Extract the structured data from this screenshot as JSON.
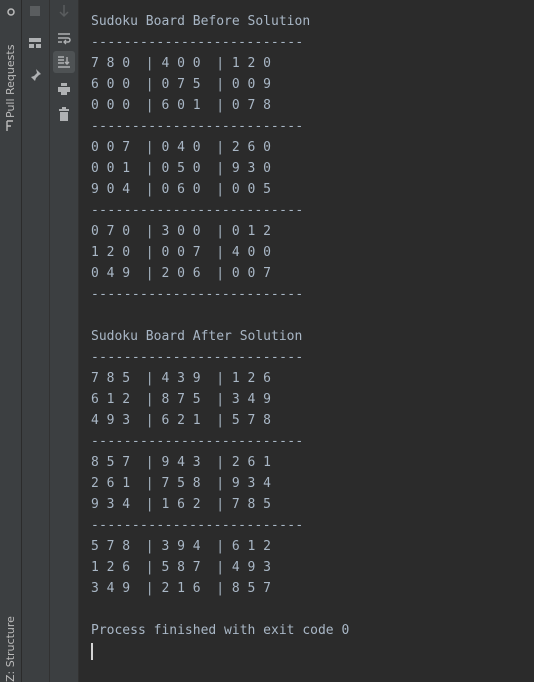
{
  "left_stripe": {
    "pull_requests_label": "Pull Requests",
    "structure_label": "Z: Structure"
  },
  "toolbar": {
    "stop_icon": "stop-icon",
    "scroll_down_icon": "arrow-down-icon",
    "layout_icon": "layout-icon",
    "soft_wrap_icon": "soft-wrap-icon",
    "pin_icon": "pin-icon",
    "scroll_to_end_icon": "scroll-to-end-icon",
    "print_icon": "print-icon",
    "trash_icon": "trash-icon"
  },
  "console": {
    "title_before": "Sudoku Board Before Solution",
    "separator": "--------------------------",
    "before_rows": [
      "7 8 0  | 4 0 0  | 1 2 0",
      "6 0 0  | 0 7 5  | 0 0 9",
      "0 0 0  | 6 0 1  | 0 7 8",
      "0 0 7  | 0 4 0  | 2 6 0",
      "0 0 1  | 0 5 0  | 9 3 0",
      "9 0 4  | 0 6 0  | 0 0 5",
      "0 7 0  | 3 0 0  | 0 1 2",
      "1 2 0  | 0 0 7  | 4 0 0",
      "0 4 9  | 2 0 6  | 0 0 7"
    ],
    "title_after": "Sudoku Board After Solution",
    "after_rows": [
      "7 8 5  | 4 3 9  | 1 2 6",
      "6 1 2  | 8 7 5  | 3 4 9",
      "4 9 3  | 6 2 1  | 5 7 8",
      "8 5 7  | 9 4 3  | 2 6 1",
      "2 6 1  | 7 5 8  | 9 3 4",
      "9 3 4  | 1 6 2  | 7 8 5",
      "5 7 8  | 3 9 4  | 6 1 2",
      "1 2 6  | 5 8 7  | 4 9 3",
      "3 4 9  | 2 1 6  | 8 5 7"
    ],
    "exit_message": "Process finished with exit code 0"
  },
  "colors": {
    "background": "#2b2b2b",
    "panel": "#3c3f41",
    "text": "#a9b7c6"
  }
}
